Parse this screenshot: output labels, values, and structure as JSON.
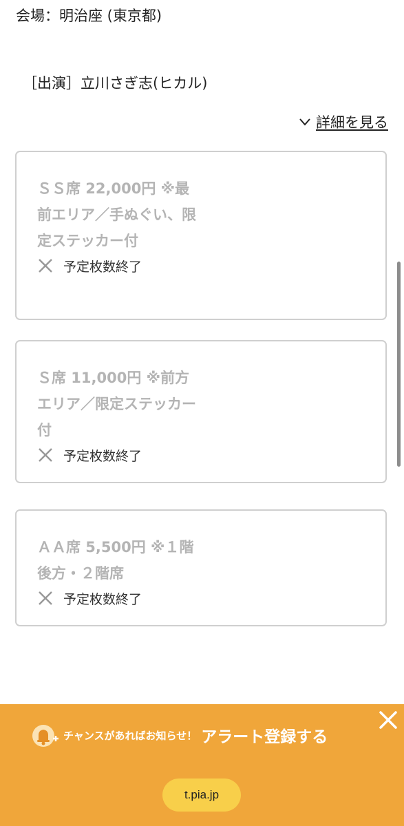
{
  "event": {
    "venue": "会場：明治座 (東京都)",
    "performer": "［出演］立川さぎ志(ヒカル)",
    "details_link": "詳細を見る"
  },
  "tickets": [
    {
      "title": "ＳＳ席 22,000円 ※最前エリア／手ぬぐい、限定ステッカー付",
      "status": "予定枚数終了"
    },
    {
      "title": "Ｓ席 11,000円 ※前方エリア／限定ステッカー付",
      "status": "予定枚数終了"
    },
    {
      "title": "ＡＡ席 5,500円 ※１階後方・２階席",
      "status": "予定枚数終了"
    }
  ],
  "banner": {
    "prompt": "チャンスがあればお知らせ！",
    "cta": "アラート登録する",
    "url": "t.pia.jp"
  },
  "colors": {
    "banner_bg": "#f0a63a",
    "url_pill": "#f8cf4a",
    "disabled_text": "#b4b4b4",
    "card_border": "#cfcfcf"
  }
}
